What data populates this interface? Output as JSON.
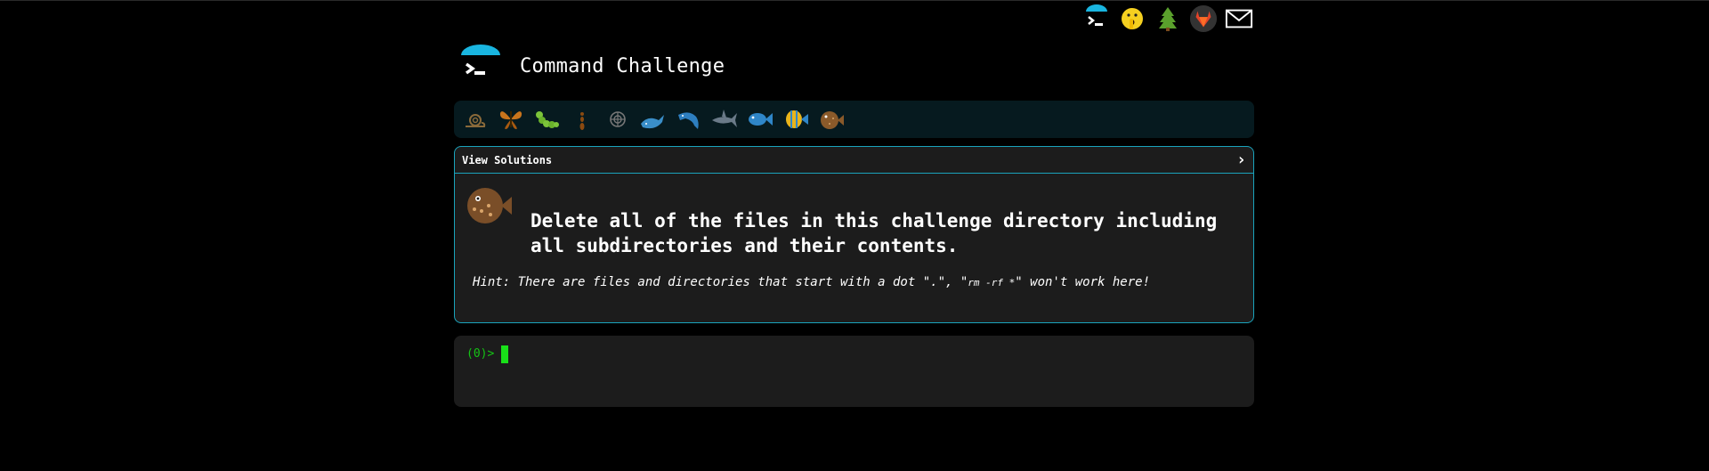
{
  "app": {
    "title": "Command Challenge"
  },
  "top_icons": [
    {
      "name": "terminal-logo-icon"
    },
    {
      "name": "shush-emoji-icon"
    },
    {
      "name": "tree-icon"
    },
    {
      "name": "gitlab-icon"
    },
    {
      "name": "mail-icon"
    }
  ],
  "levels": [
    {
      "name": "snail-icon"
    },
    {
      "name": "butterfly-icon"
    },
    {
      "name": "caterpillar-icon"
    },
    {
      "name": "ant-icon"
    },
    {
      "name": "shell-icon"
    },
    {
      "name": "whale-icon"
    },
    {
      "name": "dolphin-icon"
    },
    {
      "name": "shark-icon"
    },
    {
      "name": "fish-icon"
    },
    {
      "name": "tropical-fish-icon"
    },
    {
      "name": "blowfish-icon"
    }
  ],
  "panel": {
    "header_label": "View Solutions",
    "question": "Delete all of the files in this challenge directory including all subdirectories and their contents.",
    "hint_prefix": "Hint: There are files and directories that start with a dot \".\", \"",
    "hint_code": "rm -rf *",
    "hint_suffix": "\" won't work here!"
  },
  "terminal": {
    "prompt": "(0)>"
  },
  "colors": {
    "accent": "#1aa3bc",
    "panel_bg": "#1c1c1c",
    "levels_bg": "#061a1f",
    "prompt_green": "#14c414",
    "page_bg": "#000000"
  }
}
